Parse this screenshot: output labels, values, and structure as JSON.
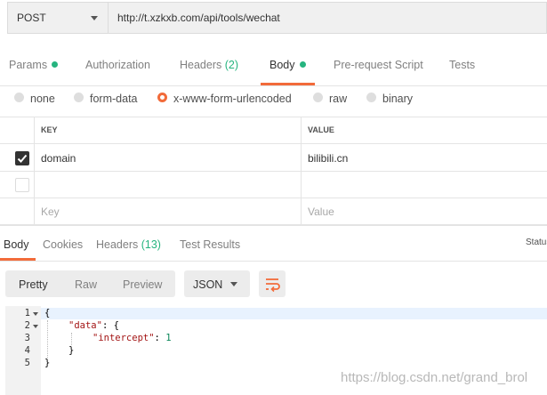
{
  "request": {
    "method": "POST",
    "url": "http://t.xzkxb.com/api/tools/wechat"
  },
  "request_tabs": {
    "params": "Params",
    "authorization": "Authorization",
    "headers": "Headers",
    "headers_count": "(2)",
    "body": "Body",
    "prerequest": "Pre-request Script",
    "tests": "Tests"
  },
  "body_types": {
    "none": "none",
    "form_data": "form-data",
    "urlencoded": "x-www-form-urlencoded",
    "raw": "raw",
    "binary": "binary",
    "selected": "x-www-form-urlencoded"
  },
  "kv_table": {
    "key_header": "KEY",
    "value_header": "VALUE",
    "rows": [
      {
        "checked": true,
        "key": "domain",
        "value": "bilibili.cn"
      }
    ],
    "key_placeholder": "Key",
    "value_placeholder": "Value"
  },
  "response_tabs": {
    "body": "Body",
    "cookies": "Cookies",
    "headers": "Headers",
    "headers_count": "(13)",
    "test_results": "Test Results",
    "status": "Status"
  },
  "response_toolbar": {
    "pretty": "Pretty",
    "raw": "Raw",
    "preview": "Preview",
    "format": "JSON"
  },
  "editor": {
    "line_numbers": [
      "1",
      "2",
      "3",
      "4",
      "5"
    ],
    "line1": "{",
    "key_data": "\"data\"",
    "colon_brace": ": {",
    "key_intercept": "\"intercept\"",
    "colon": ": ",
    "intercept_value": "1",
    "line4": "}",
    "line5": "}"
  },
  "watermark": "https://blog.csdn.net/grand_brol",
  "colors": {
    "accent": "#f26b3a",
    "status_green": "#26b47f"
  },
  "icons": [
    "chevron-down-icon",
    "checkbox-checked-icon",
    "wrap-lines-icon",
    "fold-arrow-icon"
  ]
}
